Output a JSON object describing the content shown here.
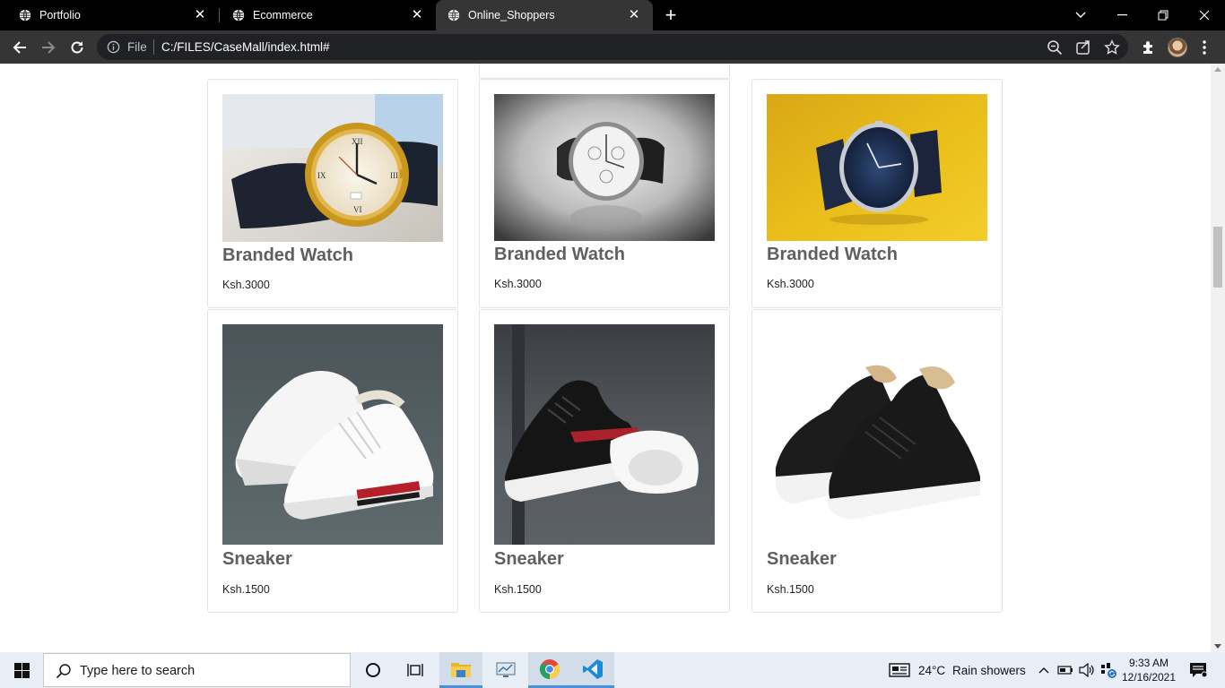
{
  "browser": {
    "tabs": [
      {
        "title": "Portfolio",
        "active": false
      },
      {
        "title": "Ecommerce",
        "active": false
      },
      {
        "title": "Online_Shoppers",
        "active": true
      }
    ],
    "address": {
      "scheme_label": "File",
      "url": "C:/FILES/CaseMall/index.html#"
    }
  },
  "products": [
    {
      "name": "Branded Watch",
      "price": "Ksh.3000",
      "image": "gold-watch-photo"
    },
    {
      "name": "Branded Watch",
      "price": "Ksh.3000",
      "image": "silver-watch-photo"
    },
    {
      "name": "Branded Watch",
      "price": "Ksh.3000",
      "image": "blue-watch-photo"
    },
    {
      "name": "Sneaker",
      "price": "Ksh.1500",
      "image": "white-sneaker-photo"
    },
    {
      "name": "Sneaker",
      "price": "Ksh.1500",
      "image": "black-white-sneaker-photo"
    },
    {
      "name": "Sneaker",
      "price": "Ksh.1500",
      "image": "black-fur-boot-photo"
    }
  ],
  "taskbar": {
    "search_placeholder": "Type here to search",
    "weather_temp": "24°C",
    "weather_text": "Rain showers",
    "time": "9:33 AM",
    "date": "12/16/2021"
  }
}
